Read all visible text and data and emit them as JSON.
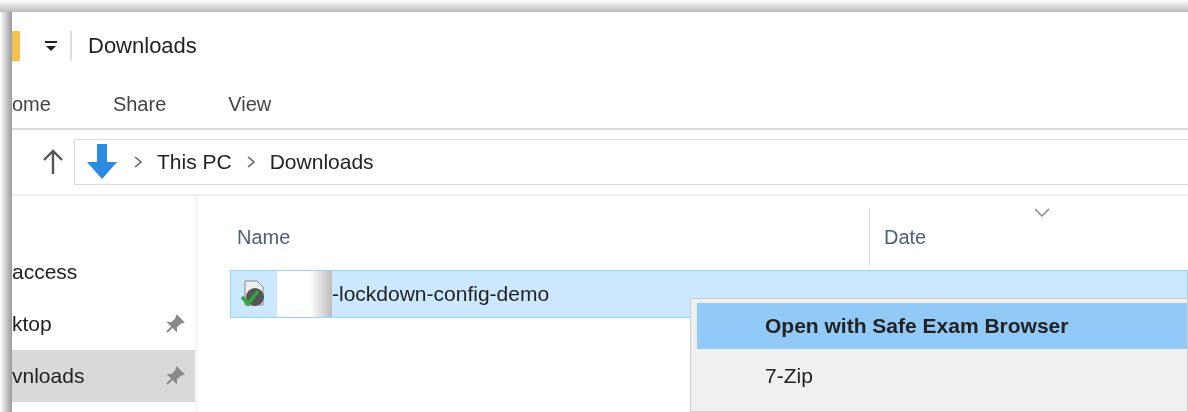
{
  "window": {
    "title": "Downloads"
  },
  "ribbon_tabs": [
    {
      "label": "ome"
    },
    {
      "label": "Share"
    },
    {
      "label": "View"
    }
  ],
  "address_bar": {
    "path": [
      "This PC",
      "Downloads"
    ]
  },
  "nav_pane": {
    "items": [
      {
        "label": "access",
        "pinned": false,
        "selected": false
      },
      {
        "label": "ktop",
        "pinned": true,
        "selected": false
      },
      {
        "label": "vnloads",
        "pinned": true,
        "selected": true
      }
    ]
  },
  "file_list": {
    "columns": [
      {
        "label": "Name",
        "sorted": false
      },
      {
        "label": "Date",
        "sorted": true
      }
    ],
    "rows": [
      {
        "name": "-lockdown-config-demo",
        "selected": true,
        "redacted_prefix": true
      }
    ]
  },
  "context_menu": {
    "items": [
      {
        "label": "Open with Safe Exam Browser",
        "selected": true,
        "default": true
      },
      {
        "label": "7-Zip",
        "selected": false,
        "default": false
      }
    ]
  }
}
